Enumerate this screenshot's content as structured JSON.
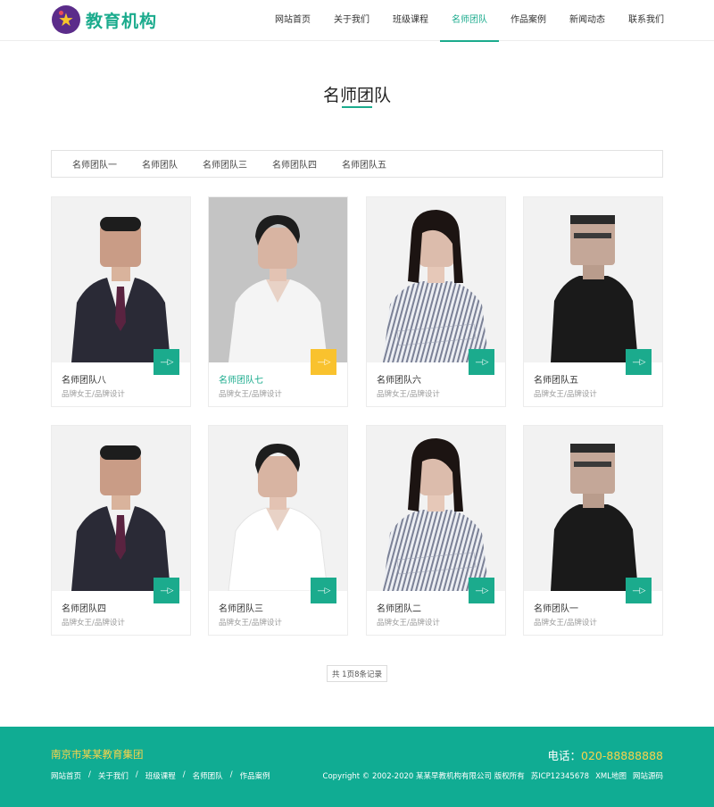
{
  "site": {
    "logo_text": "教育机构",
    "logo_icon": "star-badge-icon",
    "accent_color": "#1bab8d",
    "highlight_color": "#f9c22e"
  },
  "nav": [
    {
      "label": "网站首页",
      "active": false
    },
    {
      "label": "关于我们",
      "active": false
    },
    {
      "label": "班级课程",
      "active": false
    },
    {
      "label": "名师团队",
      "active": true
    },
    {
      "label": "作品案例",
      "active": false
    },
    {
      "label": "新闻动态",
      "active": false
    },
    {
      "label": "联系我们",
      "active": false
    }
  ],
  "section": {
    "title": "名师团队"
  },
  "categories": [
    "名师团队一",
    "名师团队",
    "名师团队三",
    "名师团队四",
    "名师团队五"
  ],
  "teachers": [
    {
      "name": "名师团队八",
      "desc": "品牌女王/品牌设计",
      "portrait": "male-suit-portrait",
      "highlight": false
    },
    {
      "name": "名师团队七",
      "desc": "品牌女王/品牌设计",
      "portrait": "female-white-shirt-portrait",
      "highlight": true
    },
    {
      "name": "名师团队六",
      "desc": "品牌女王/品牌设计",
      "portrait": "female-striped-shirt-portrait",
      "highlight": false
    },
    {
      "name": "名师团队五",
      "desc": "品牌女王/品牌设计",
      "portrait": "male-black-shirt-portrait",
      "highlight": false
    },
    {
      "name": "名师团队四",
      "desc": "品牌女王/品牌设计",
      "portrait": "male-suit-portrait",
      "highlight": false
    },
    {
      "name": "名师团队三",
      "desc": "品牌女王/品牌设计",
      "portrait": "female-white-shirt-portrait",
      "highlight": false
    },
    {
      "name": "名师团队二",
      "desc": "品牌女王/品牌设计",
      "portrait": "female-striped-shirt-portrait",
      "highlight": false
    },
    {
      "name": "名师团队一",
      "desc": "品牌女王/品牌设计",
      "portrait": "male-black-shirt-portrait",
      "highlight": false
    }
  ],
  "arrow_glyph": "—▷",
  "pagination": {
    "text": "共 1页8条记录"
  },
  "footer": {
    "company": "南京市某某教育集团",
    "phone_label": "电话：",
    "phone": "020-88888888",
    "links": [
      "网站首页",
      "关于我们",
      "班级课程",
      "名师团队",
      "作品案例"
    ],
    "link_separator": "/",
    "copyright": "Copyright © 2002-2020 某某早教机构有限公司 版权所有",
    "icp": "苏ICP12345678",
    "xml_map": "XML地图",
    "source": "网站源码"
  }
}
